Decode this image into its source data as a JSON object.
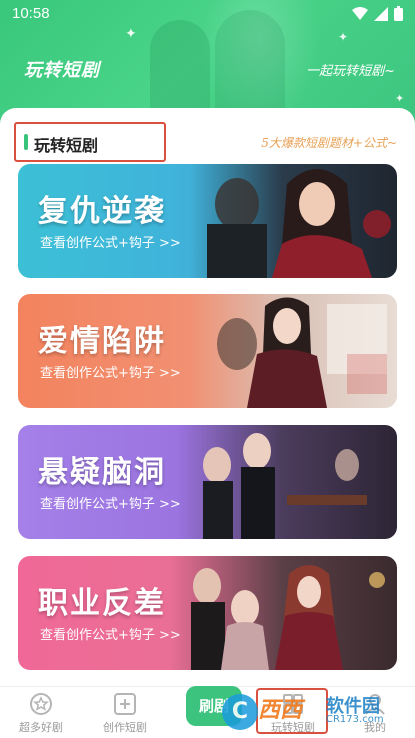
{
  "status_bar": {
    "time": "10:58"
  },
  "header": {
    "title": "玩转短剧",
    "slogan": "一起玩转短剧~"
  },
  "section": {
    "title": "玩转短剧",
    "subtitle": "5大爆款短剧题材+公式~"
  },
  "cards": [
    {
      "title": "复仇逆袭",
      "cta": "查看创作公式+钩子 >>"
    },
    {
      "title": "爱情陷阱",
      "cta": "查看创作公式+钩子 >>"
    },
    {
      "title": "悬疑脑洞",
      "cta": "查看创作公式+钩子 >>"
    },
    {
      "title": "职业反差",
      "cta": "查看创作公式+钩子 >>"
    }
  ],
  "tabs": [
    {
      "label": "超多好剧",
      "icon": "star-badge-icon"
    },
    {
      "label": "创作短剧",
      "icon": "plus-square-icon"
    },
    {
      "label": "刷剧",
      "icon": "play-icon"
    },
    {
      "label": "玩转短剧",
      "icon": "grid-icon"
    },
    {
      "label": "我的",
      "icon": "user-icon"
    }
  ],
  "watermark": {
    "circle": "C",
    "mid": "西西",
    "text": "软件园",
    "url": "CR173.com"
  },
  "colors": {
    "accent": "#3cc47e",
    "highlight_box": "#d9503f",
    "subtitle": "#e8a054"
  }
}
